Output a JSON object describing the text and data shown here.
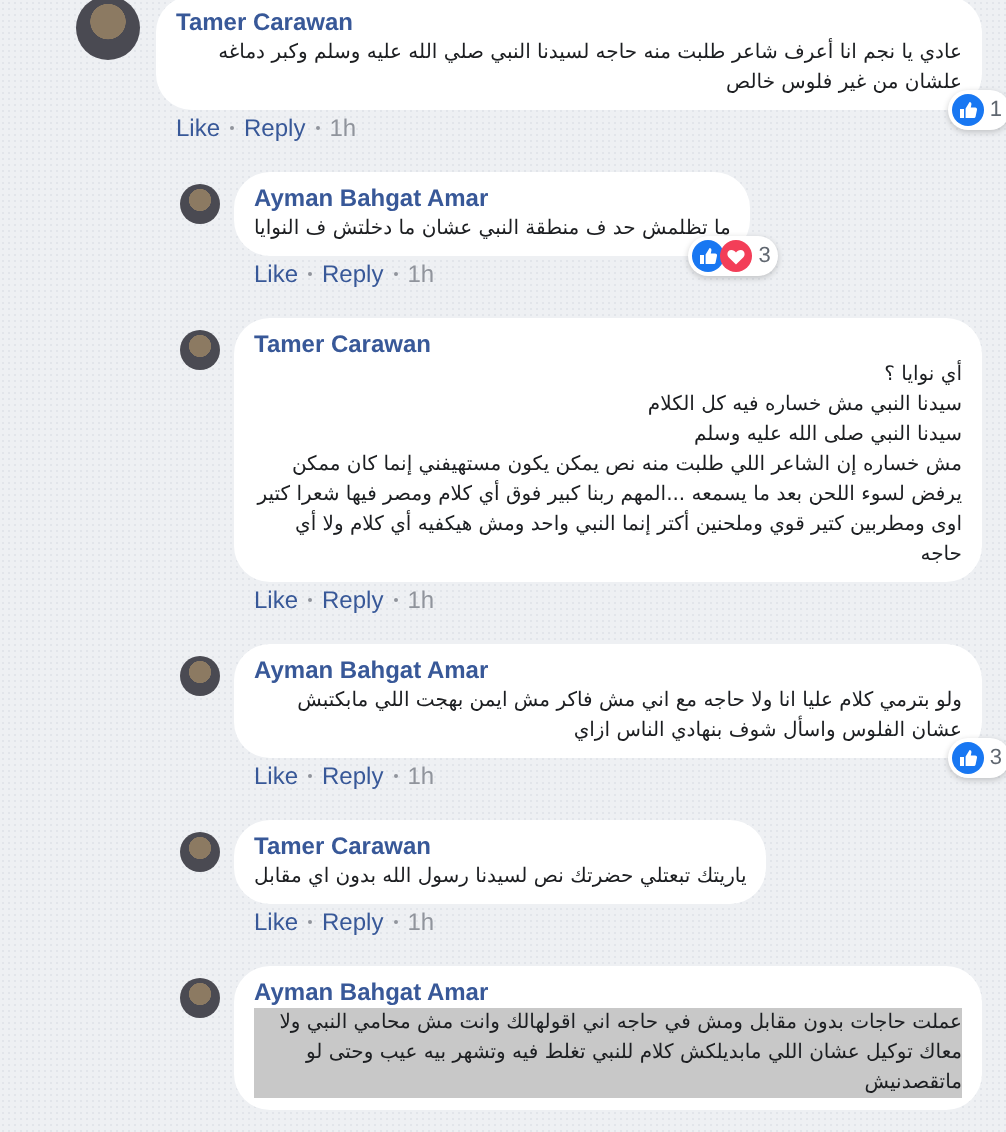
{
  "comments": [
    {
      "author": "Tamer Carawan",
      "text": "عادي يا نجم انا أعرف شاعر طلبت منه حاجه لسيدنا النبي صلي الله عليه وسلم وكبر دماغه علشان من غير فلوس خالص",
      "selected": false,
      "reactions": {
        "like": true,
        "count": "1"
      },
      "like_label": "Like",
      "reply_label": "Reply",
      "time": "1h",
      "replies": [
        {
          "author": "Ayman Bahgat Amar",
          "text": "ما تظلمش حد ف منطقة النبي عشان ما دخلتش ف النوايا",
          "selected": false,
          "reactions": {
            "like": true,
            "love": true,
            "count": "3"
          },
          "like_label": "Like",
          "reply_label": "Reply",
          "time": "1h"
        },
        {
          "author": "Tamer Carawan",
          "text": "أي نوايا ؟\nسيدنا النبي مش خساره فيه كل الكلام\nسيدنا النبي صلى الله عليه وسلم\nمش خساره إن الشاعر اللي طلبت منه نص يمكن يكون مستهيفني إنما كان ممكن يرفض لسوء اللحن بعد ما يسمعه ...المهم ربنا كبير فوق أي كلام ومصر فيها شعرا كتير اوى ومطربين كتير قوي وملحنين أكتر إنما النبي واحد ومش هيكفيه أي كلام ولا أي حاجه",
          "selected": false,
          "like_label": "Like",
          "reply_label": "Reply",
          "time": "1h"
        },
        {
          "author": "Ayman Bahgat Amar",
          "text": "ولو بترمي كلام عليا انا ولا حاجه مع اني مش فاكر مش ايمن بهجت اللي مابكتبش عشان الفلوس واسأل شوف بنهادي الناس ازاي",
          "selected": false,
          "reactions": {
            "like": true,
            "count": "3"
          },
          "like_label": "Like",
          "reply_label": "Reply",
          "time": "1h"
        },
        {
          "author": "Tamer Carawan",
          "text": "ياريتك تبعتلي حضرتك نص لسيدنا رسول الله بدون اي مقابل",
          "selected": false,
          "like_label": "Like",
          "reply_label": "Reply",
          "time": "1h"
        },
        {
          "author": "Ayman Bahgat Amar",
          "text": "عملت حاجات بدون مقابل ومش في حاجه اني اقولهالك وانت مش محامي النبي ولا معاك توكيل عشان اللي مابديلكش كلام للنبي تغلط فيه وتشهر بيه عيب وحتى لو ماتقصدنيش",
          "selected": true
        }
      ]
    }
  ]
}
